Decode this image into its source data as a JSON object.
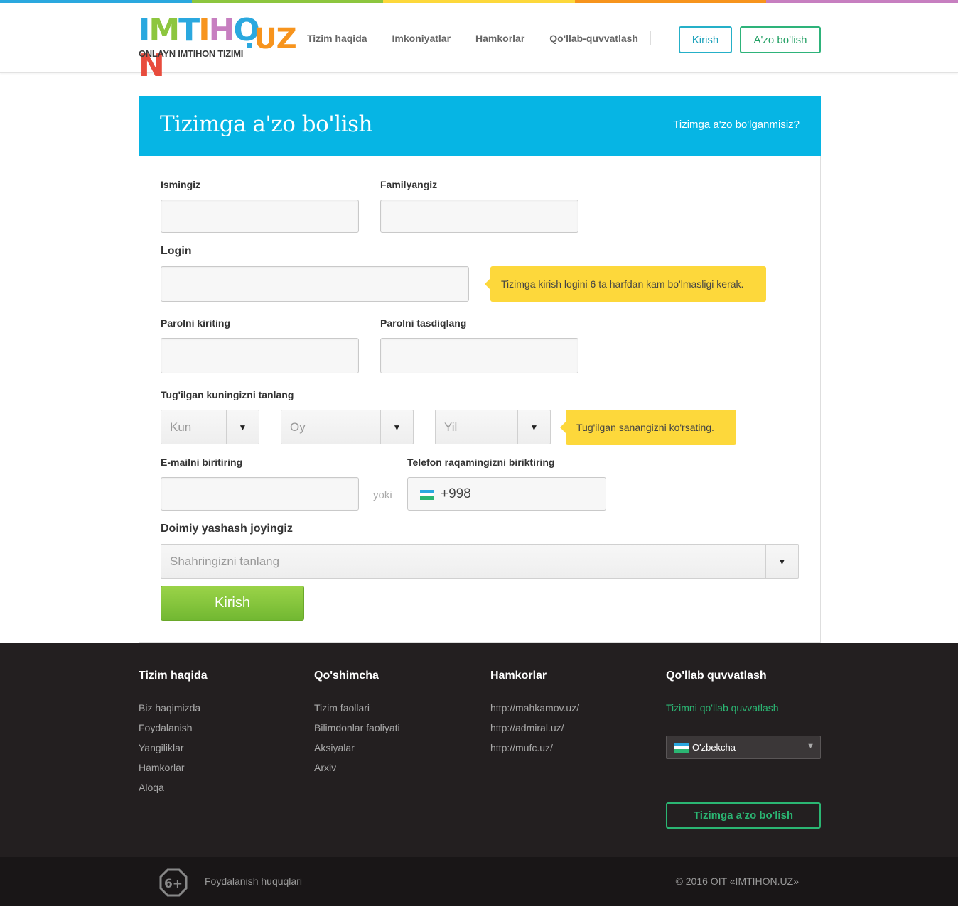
{
  "brand": {
    "logo_text": "IMTIHON",
    "logo_suffix": ".UZ",
    "logo_subtitle": "ONLAYN IMTIHON TIZIMI",
    "top_stripe_colors": [
      "#2aa8df",
      "#8dc63f",
      "#fdd83b",
      "#f7941d",
      "#c77fc0"
    ]
  },
  "nav": {
    "items": [
      {
        "label": "Tizim haqida"
      },
      {
        "label": "Imkoniyatlar"
      },
      {
        "label": "Hamkorlar"
      },
      {
        "label": "Qo'llab-quvvatlash"
      }
    ],
    "login_label": "Kirish",
    "register_label": "A'zo bo'lish"
  },
  "form": {
    "title": "Tizimga a'zo bo'lish",
    "already_member_link": "Tizimga a'zo bo'lganmisiz?",
    "first_name_label": "Ismingiz",
    "last_name_label": "Familyangiz",
    "login_label": "Login",
    "login_hint": "Tizimga kirish logini 6 ta harfdan kam bo'lmasligi kerak.",
    "password_label": "Parolni kiriting",
    "password_confirm_label": "Parolni tasdiqlang",
    "birthday_label": "Tug'ilgan kuningizni tanlang",
    "day_placeholder": "Kun",
    "month_placeholder": "Oy",
    "year_placeholder": "Yil",
    "birthday_hint": "Tug'ilgan sanangizni ko'rsating.",
    "email_label": "E-mailni biritiring",
    "or_text": "yoki",
    "phone_label": "Telefon raqamingizni biriktiring",
    "phone_code": "+998",
    "residence_label": "Doimiy yashash joyingiz",
    "city_placeholder": "Shahringizni tanlang",
    "submit_label": "Kirish",
    "header_color": "#06b5e4",
    "hint_color": "#fdd83b",
    "submit_color": "#7dbf3a"
  },
  "footer": {
    "col1": {
      "title": "Tizim haqida",
      "links": [
        "Biz haqimizda",
        "Foydalanish",
        "Yangiliklar",
        "Hamkorlar",
        "Aloqa"
      ]
    },
    "col2": {
      "title": "Qo'shimcha",
      "links": [
        "Tizim faollari",
        "Bilimdonlar faoliyati",
        "Aksiyalar",
        "Arxiv"
      ]
    },
    "col3": {
      "title": "Hamkorlar",
      "links": [
        "http://mahkamov.uz/",
        "http://admiral.uz/",
        "http://mufc.uz/"
      ]
    },
    "col4": {
      "title": "Qo'llab quvvatlash",
      "support_link": "Tizimni qo'llab quvvatlash"
    },
    "language": "O'zbekcha",
    "register_button": "Tizimga a'zo bo'lish",
    "age_rating": "6+",
    "rights_link": "Foydalanish huquqlari",
    "copyright": "© 2016 OIT «IMTIHON.UZ»",
    "accent_color": "#2bb673"
  }
}
